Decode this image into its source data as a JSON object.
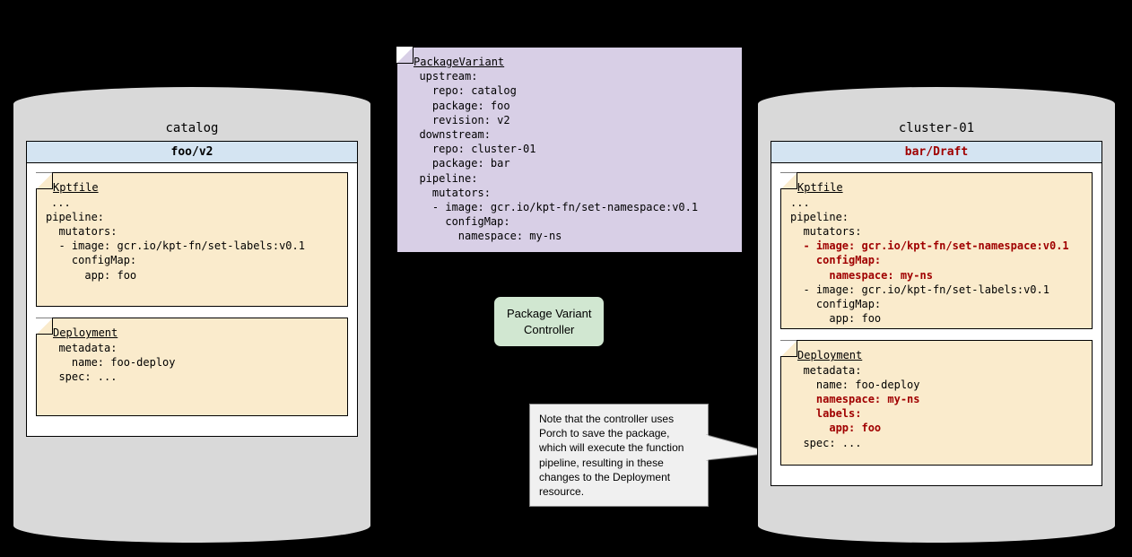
{
  "left_db": {
    "title": "catalog",
    "pkg_header": "foo/v2",
    "kptfile": {
      "title": "Kptfile",
      "body": "...\npipeline:\n  mutators:\n  - image: gcr.io/kpt-fn/set-labels:v0.1\n    configMap:\n      app: foo"
    },
    "deploy": {
      "title": "Deployment",
      "body": "  metadata:\n    name: foo-deploy\n  spec: ..."
    }
  },
  "packagevariant": {
    "title": "PackageVariant",
    "body": "  upstream:\n    repo: catalog\n    package: foo\n    revision: v2\n  downstream:\n    repo: cluster-01\n    package: bar\n  pipeline:\n    mutators:\n    - image: gcr.io/kpt-fn/set-namespace:v0.1\n      configMap:\n        namespace: my-ns"
  },
  "controller": "Package Variant\nController",
  "note_text": "Note that the controller uses Porch to save the package, which will execute the function pipeline, resulting in these changes to the Deployment resource.",
  "right_db": {
    "title": "cluster-01",
    "pkg_header": "bar/Draft",
    "kptfile": {
      "title": "Kptfile",
      "pre": "...\npipeline:\n  mutators:",
      "red": "  - image: gcr.io/kpt-fn/set-namespace:v0.1\n    configMap:\n      namespace: my-ns",
      "post": "  - image: gcr.io/kpt-fn/set-labels:v0.1\n    configMap:\n      app: foo"
    },
    "deploy": {
      "title": "Deployment",
      "line1": "  metadata:",
      "line2": "    name: foo-deploy",
      "red": "    namespace: my-ns\n    labels:\n      app: foo",
      "line3": "  spec: ..."
    }
  }
}
